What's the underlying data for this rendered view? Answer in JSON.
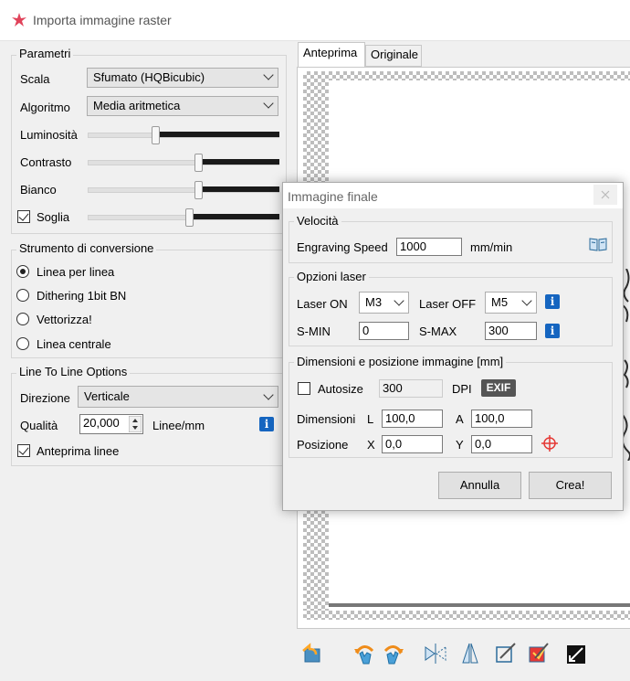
{
  "window": {
    "title": "Importa immagine raster"
  },
  "params": {
    "group_label": "Parametri",
    "scala_label": "Scala",
    "scala_value": "Sfumato (HQBicubic)",
    "algoritmo_label": "Algoritmo",
    "algoritmo_value": "Media aritmetica",
    "luminosita_label": "Luminosità",
    "contrasto_label": "Contrasto",
    "bianco_label": "Bianco",
    "soglia_label": "Soglia",
    "soglia_checked": true,
    "sliders": {
      "luminosita": 0.35,
      "contrasto": 0.58,
      "bianco": 0.58,
      "soglia": 0.53
    }
  },
  "conversion": {
    "group_label": "Strumento di conversione",
    "options": [
      "Linea per linea",
      "Dithering 1bit BN",
      "Vettorizza!",
      "Linea centrale"
    ],
    "selected_index": 0
  },
  "ltl": {
    "group_label": "Line To Line Options",
    "direzione_label": "Direzione",
    "direzione_value": "Verticale",
    "qualita_label": "Qualità",
    "qualita_value": "20,000",
    "qualita_unit": "Linee/mm",
    "anteprima_label": "Anteprima linee",
    "anteprima_checked": true
  },
  "tabs": {
    "preview": "Anteprima",
    "original": "Originale"
  },
  "dialog": {
    "title": "Immagine finale",
    "velocita_group": "Velocità",
    "engraving_label": "Engraving Speed",
    "engraving_value": "1000",
    "engraving_unit": "mm/min",
    "laser_group": "Opzioni laser",
    "laser_on_label": "Laser ON",
    "laser_on_value": "M3",
    "laser_off_label": "Laser OFF",
    "laser_off_value": "M5",
    "smin_label": "S-MIN",
    "smin_value": "0",
    "smax_label": "S-MAX",
    "smax_value": "300",
    "dim_group": "Dimensioni e posizione immagine [mm]",
    "autosize_label": "Autosize",
    "autosize_checked": false,
    "dpi_value": "300",
    "dpi_label": "DPI",
    "exif_label": "EXIF",
    "dimensioni_label": "Dimensioni",
    "l_label": "L",
    "l_value": "100,0",
    "a_label": "A",
    "a_value": "100,0",
    "posizione_label": "Posizione",
    "x_label": "X",
    "x_value": "0,0",
    "y_label": "Y",
    "y_value": "0,0",
    "cancel_label": "Annulla",
    "create_label": "Crea!"
  },
  "toolbar": {
    "icons": [
      "reset-icon",
      "rotate-ccw-icon",
      "rotate-cw-icon",
      "flip-horizontal-icon",
      "flip-vertical-icon",
      "crop-icon",
      "autotrim-icon",
      "invert-icon"
    ]
  }
}
